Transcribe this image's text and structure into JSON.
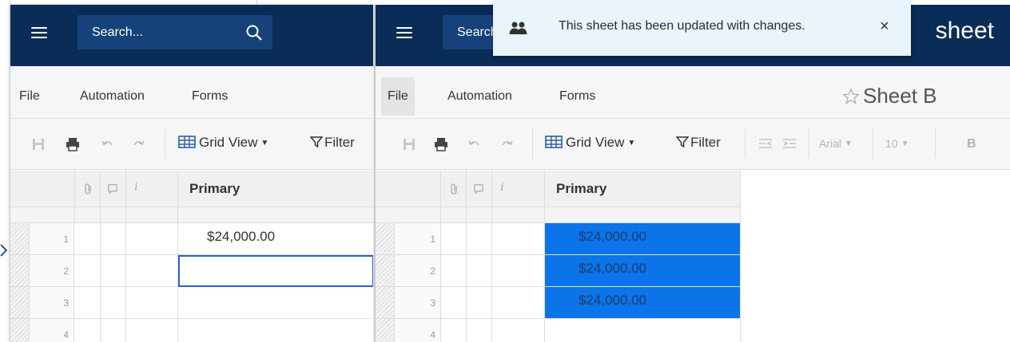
{
  "colors": {
    "topbar": "#0a2d57",
    "search_bg": "#15427a",
    "selection": "#0a74e8",
    "toast_bg": "#e9f4fc"
  },
  "pane_a": {
    "search_placeholder": "Search...",
    "menu": [
      "File",
      "Automation",
      "Forms"
    ],
    "toolbar": {
      "grid_view": "Grid View",
      "filter": "Filter"
    },
    "column_header": "Primary",
    "rows": [
      {
        "num": "1",
        "value": "$24,000.00"
      },
      {
        "num": "2",
        "value": ""
      },
      {
        "num": "3",
        "value": ""
      },
      {
        "num": "4",
        "value": ""
      }
    ]
  },
  "pane_b": {
    "search_placeholder": "Search...",
    "brand": "sheet",
    "menu": [
      "File",
      "Automation",
      "Forms"
    ],
    "sheet_title": "Sheet B",
    "toolbar": {
      "grid_view": "Grid View",
      "filter": "Filter",
      "font": "Arial",
      "font_size": "10",
      "bold": "B"
    },
    "column_header": "Primary",
    "rows": [
      {
        "num": "1",
        "value": "$24,000.00"
      },
      {
        "num": "2",
        "value": "$24,000.00"
      },
      {
        "num": "3",
        "value": "$24,000.00"
      },
      {
        "num": "4",
        "value": ""
      }
    ]
  },
  "toast": {
    "message": "This sheet has been updated with changes.",
    "close": "×",
    "icon": "users-icon"
  }
}
